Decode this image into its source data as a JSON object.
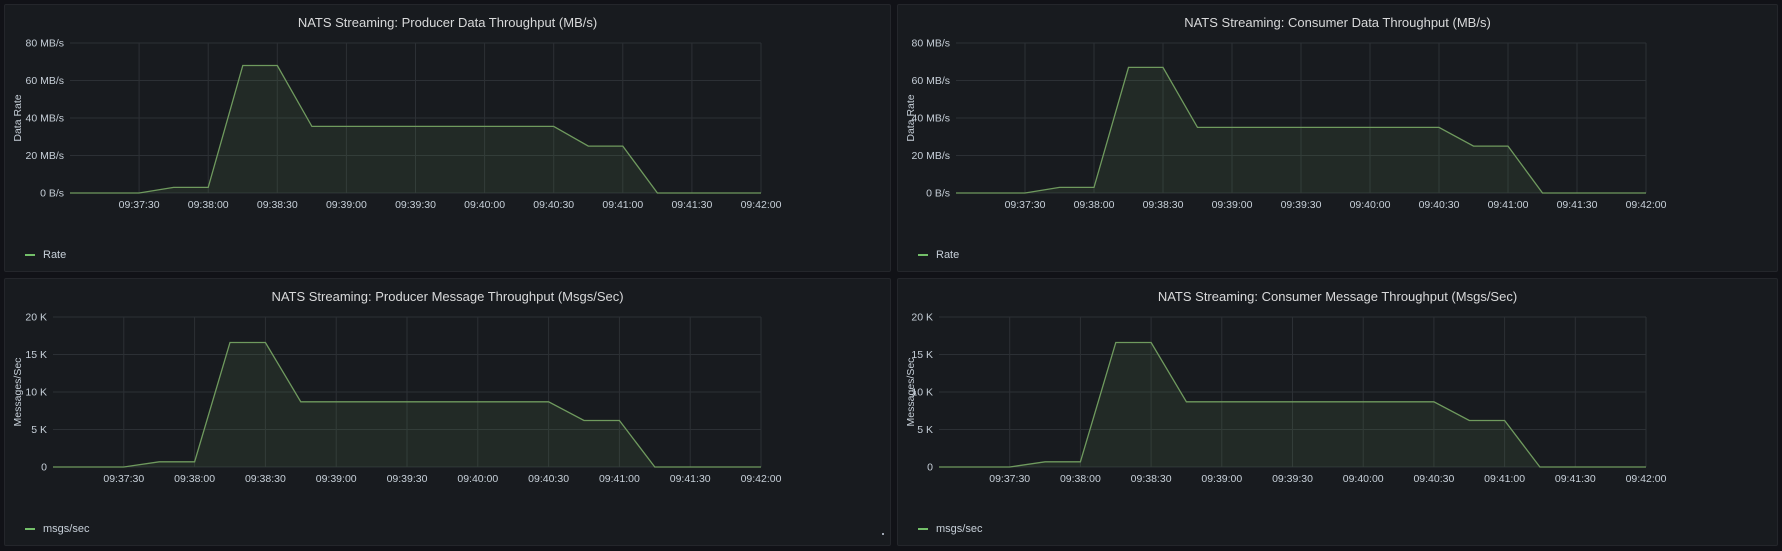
{
  "colors": {
    "line": "#6f9a5e",
    "fill": "#6f9a5e",
    "grid": "#2c3035",
    "background": "#181b1f"
  },
  "panels": [
    {
      "title": "NATS Streaming: Producer Data Throughput (MB/s)",
      "legend": "Rate"
    },
    {
      "title": "NATS Streaming: Consumer Data Throughput (MB/s)",
      "legend": "Rate"
    },
    {
      "title": "NATS Streaming: Producer Message Throughput (Msgs/Sec)",
      "legend": "msgs/sec"
    },
    {
      "title": "NATS Streaming: Consumer Message Throughput (Msgs/Sec)",
      "legend": "msgs/sec"
    }
  ],
  "chart_data": [
    {
      "type": "area",
      "title": "NATS Streaming: Producer Data Throughput (MB/s)",
      "ylabel": "Data Rate",
      "ylim": [
        0,
        80
      ],
      "y_ticks": [
        "0 B/s",
        "20 MB/s",
        "40 MB/s",
        "60 MB/s",
        "80 MB/s"
      ],
      "x_ticks": [
        "09:37:30",
        "09:38:00",
        "09:38:30",
        "09:39:00",
        "09:39:30",
        "09:40:00",
        "09:40:30",
        "09:41:00",
        "09:41:30",
        "09:42:00"
      ],
      "xlim": [
        "09:37:00",
        "09:42:00"
      ],
      "grid": true,
      "legend_placement": "bottom-left",
      "series": [
        {
          "name": "Rate",
          "x": [
            "09:37:00",
            "09:37:30",
            "09:37:45",
            "09:38:00",
            "09:38:15",
            "09:38:30",
            "09:38:45",
            "09:39:00",
            "09:39:30",
            "09:40:00",
            "09:40:30",
            "09:40:45",
            "09:41:00",
            "09:41:15",
            "09:41:30",
            "09:42:00"
          ],
          "values": [
            0,
            0,
            3,
            3,
            68,
            68,
            35.5,
            35.5,
            35.5,
            35.5,
            35.5,
            25,
            25,
            0,
            0,
            0
          ]
        }
      ]
    },
    {
      "type": "area",
      "title": "NATS Streaming: Consumer Data Throughput (MB/s)",
      "ylabel": "Data Rate",
      "ylim": [
        0,
        80
      ],
      "y_ticks": [
        "0 B/s",
        "20 MB/s",
        "40 MB/s",
        "60 MB/s",
        "80 MB/s"
      ],
      "x_ticks": [
        "09:37:30",
        "09:38:00",
        "09:38:30",
        "09:39:00",
        "09:39:30",
        "09:40:00",
        "09:40:30",
        "09:41:00",
        "09:41:30",
        "09:42:00"
      ],
      "xlim": [
        "09:37:00",
        "09:42:00"
      ],
      "grid": true,
      "legend_placement": "bottom-left",
      "series": [
        {
          "name": "Rate",
          "x": [
            "09:37:00",
            "09:37:30",
            "09:37:45",
            "09:38:00",
            "09:38:15",
            "09:38:30",
            "09:38:45",
            "09:39:00",
            "09:39:30",
            "09:40:00",
            "09:40:30",
            "09:40:45",
            "09:41:00",
            "09:41:15",
            "09:41:30",
            "09:42:00"
          ],
          "values": [
            0,
            0,
            3,
            3,
            67,
            67,
            35,
            35,
            35,
            35,
            35,
            25,
            25,
            0,
            0,
            0
          ]
        }
      ]
    },
    {
      "type": "area",
      "title": "NATS Streaming: Producer Message Throughput (Msgs/Sec)",
      "ylabel": "Messages/Sec",
      "ylim": [
        0,
        20000
      ],
      "y_ticks": [
        "0",
        "5 K",
        "10 K",
        "15 K",
        "20 K"
      ],
      "x_ticks": [
        "09:37:30",
        "09:38:00",
        "09:38:30",
        "09:39:00",
        "09:39:30",
        "09:40:00",
        "09:40:30",
        "09:41:00",
        "09:41:30",
        "09:42:00"
      ],
      "xlim": [
        "09:37:00",
        "09:42:00"
      ],
      "grid": true,
      "legend_placement": "bottom-left",
      "series": [
        {
          "name": "msgs/sec",
          "x": [
            "09:37:00",
            "09:37:30",
            "09:37:45",
            "09:38:00",
            "09:38:15",
            "09:38:30",
            "09:38:45",
            "09:39:00",
            "09:39:30",
            "09:40:00",
            "09:40:30",
            "09:40:45",
            "09:41:00",
            "09:41:15",
            "09:41:30",
            "09:42:00"
          ],
          "values": [
            0,
            0,
            700,
            700,
            16600,
            16600,
            8700,
            8700,
            8700,
            8700,
            8700,
            6200,
            6200,
            0,
            0,
            0
          ]
        }
      ]
    },
    {
      "type": "area",
      "title": "NATS Streaming: Consumer Message Throughput (Msgs/Sec)",
      "ylabel": "Messages/Sec",
      "ylim": [
        0,
        20000
      ],
      "y_ticks": [
        "0",
        "5 K",
        "10 K",
        "15 K",
        "20 K"
      ],
      "x_ticks": [
        "09:37:30",
        "09:38:00",
        "09:38:30",
        "09:39:00",
        "09:39:30",
        "09:40:00",
        "09:40:30",
        "09:41:00",
        "09:41:30",
        "09:42:00"
      ],
      "xlim": [
        "09:37:00",
        "09:42:00"
      ],
      "grid": true,
      "legend_placement": "bottom-left",
      "series": [
        {
          "name": "msgs/sec",
          "x": [
            "09:37:00",
            "09:37:30",
            "09:37:45",
            "09:38:00",
            "09:38:15",
            "09:38:30",
            "09:38:45",
            "09:39:00",
            "09:39:30",
            "09:40:00",
            "09:40:30",
            "09:40:45",
            "09:41:00",
            "09:41:15",
            "09:41:30",
            "09:42:00"
          ],
          "values": [
            0,
            0,
            700,
            700,
            16600,
            16600,
            8700,
            8700,
            8700,
            8700,
            8700,
            6200,
            6200,
            0,
            0,
            0
          ]
        }
      ]
    }
  ]
}
